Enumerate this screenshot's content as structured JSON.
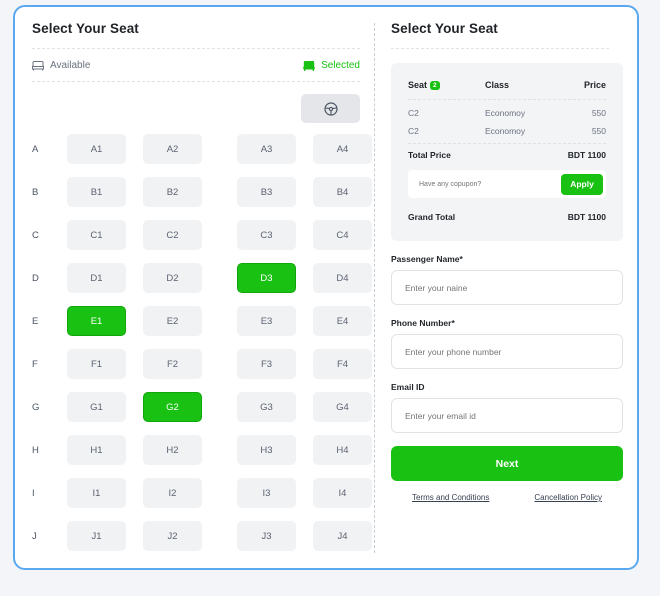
{
  "left": {
    "title": "Select Your Seat",
    "legend": {
      "available": "Available",
      "selected": "Selected"
    },
    "rows": [
      {
        "label": "A",
        "seats": [
          "A1",
          "A2",
          "A3",
          "A4"
        ]
      },
      {
        "label": "B",
        "seats": [
          "B1",
          "B2",
          "B3",
          "B4"
        ]
      },
      {
        "label": "C",
        "seats": [
          "C1",
          "C2",
          "C3",
          "C4"
        ]
      },
      {
        "label": "D",
        "seats": [
          "D1",
          "D2",
          "D3",
          "D4"
        ]
      },
      {
        "label": "E",
        "seats": [
          "E1",
          "E2",
          "E3",
          "E4"
        ]
      },
      {
        "label": "F",
        "seats": [
          "F1",
          "F2",
          "F3",
          "F4"
        ]
      },
      {
        "label": "G",
        "seats": [
          "G1",
          "G2",
          "G3",
          "G4"
        ]
      },
      {
        "label": "H",
        "seats": [
          "H1",
          "H2",
          "H3",
          "H4"
        ]
      },
      {
        "label": "I",
        "seats": [
          "I1",
          "I2",
          "I3",
          "I4"
        ]
      },
      {
        "label": "J",
        "seats": [
          "J1",
          "J2",
          "J3",
          "J4"
        ]
      }
    ],
    "selected_seats": [
      "D3",
      "E1",
      "G2"
    ]
  },
  "right": {
    "title": "Select Your Seat",
    "summary": {
      "header": {
        "seat": "Seat",
        "seat_count": "2",
        "class": "Class",
        "price": "Price"
      },
      "items": [
        {
          "seat": "C2",
          "class": "Economoy",
          "price": "550"
        },
        {
          "seat": "C2",
          "class": "Economoy",
          "price": "550"
        }
      ],
      "total_label": "Total Price",
      "total_value": "BDT 1100",
      "coupon_placeholder": "Have any copupon?",
      "apply_label": "Apply",
      "grand_total_label": "Grand Total",
      "grand_total_value": "BDT 1100"
    },
    "form": {
      "name_label": "Passenger Name*",
      "name_placeholder": "Enter your naine",
      "phone_label": "Phone Number*",
      "phone_placeholder": "Enter your phone number",
      "email_label": "Email ID",
      "email_placeholder": "Enter your email id"
    },
    "next_label": "Next",
    "links": {
      "terms": "Terms and Conditions",
      "cancellation": "Cancellation Policy"
    }
  },
  "colors": {
    "accent": "#19c112",
    "border": "#5aa8ef",
    "seat_bg": "#f1f2f4"
  },
  "icons": {
    "available": "seat-outline-icon",
    "selected": "seat-filled-icon",
    "driver": "steering-wheel-icon"
  }
}
